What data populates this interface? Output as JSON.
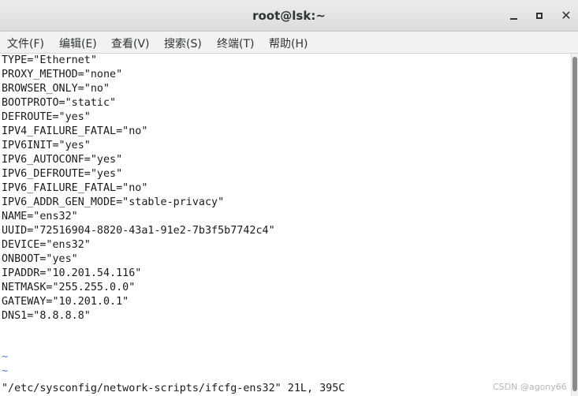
{
  "window": {
    "title": "root@lsk:~",
    "close_glyph": "✕"
  },
  "menu": [
    {
      "label": "文件(F)"
    },
    {
      "label": "编辑(E)"
    },
    {
      "label": "查看(V)"
    },
    {
      "label": "搜索(S)"
    },
    {
      "label": "终端(T)"
    },
    {
      "label": "帮助(H)"
    }
  ],
  "terminal": {
    "lines": [
      "TYPE=\"Ethernet\"",
      "PROXY_METHOD=\"none\"",
      "BROWSER_ONLY=\"no\"",
      "BOOTPROTO=\"static\"",
      "DEFROUTE=\"yes\"",
      "IPV4_FAILURE_FATAL=\"no\"",
      "IPV6INIT=\"yes\"",
      "IPV6_AUTOCONF=\"yes\"",
      "IPV6_DEFROUTE=\"yes\"",
      "IPV6_FAILURE_FATAL=\"no\"",
      "IPV6_ADDR_GEN_MODE=\"stable-privacy\"",
      "NAME=\"ens32\"",
      "UUID=\"72516904-8820-43a1-91e2-7b3f5b7742c4\"",
      "DEVICE=\"ens32\"",
      "ONBOOT=\"yes\"",
      "IPADDR=\"10.201.54.116\"",
      "NETMASK=\"255.255.0.0\"",
      "GATEWAY=\"10.201.0.1\"",
      "DNS1=\"8.8.8.8\""
    ],
    "tilde_lines": [
      "~",
      "~"
    ],
    "status_line": "\"/etc/sysconfig/network-scripts/ifcfg-ens32\" 21L, 395C"
  },
  "watermark": "CSDN @agony66",
  "colors": {
    "tilde": "#4f6fd1",
    "text": "#1a1a1a",
    "background": "#ffffff"
  }
}
